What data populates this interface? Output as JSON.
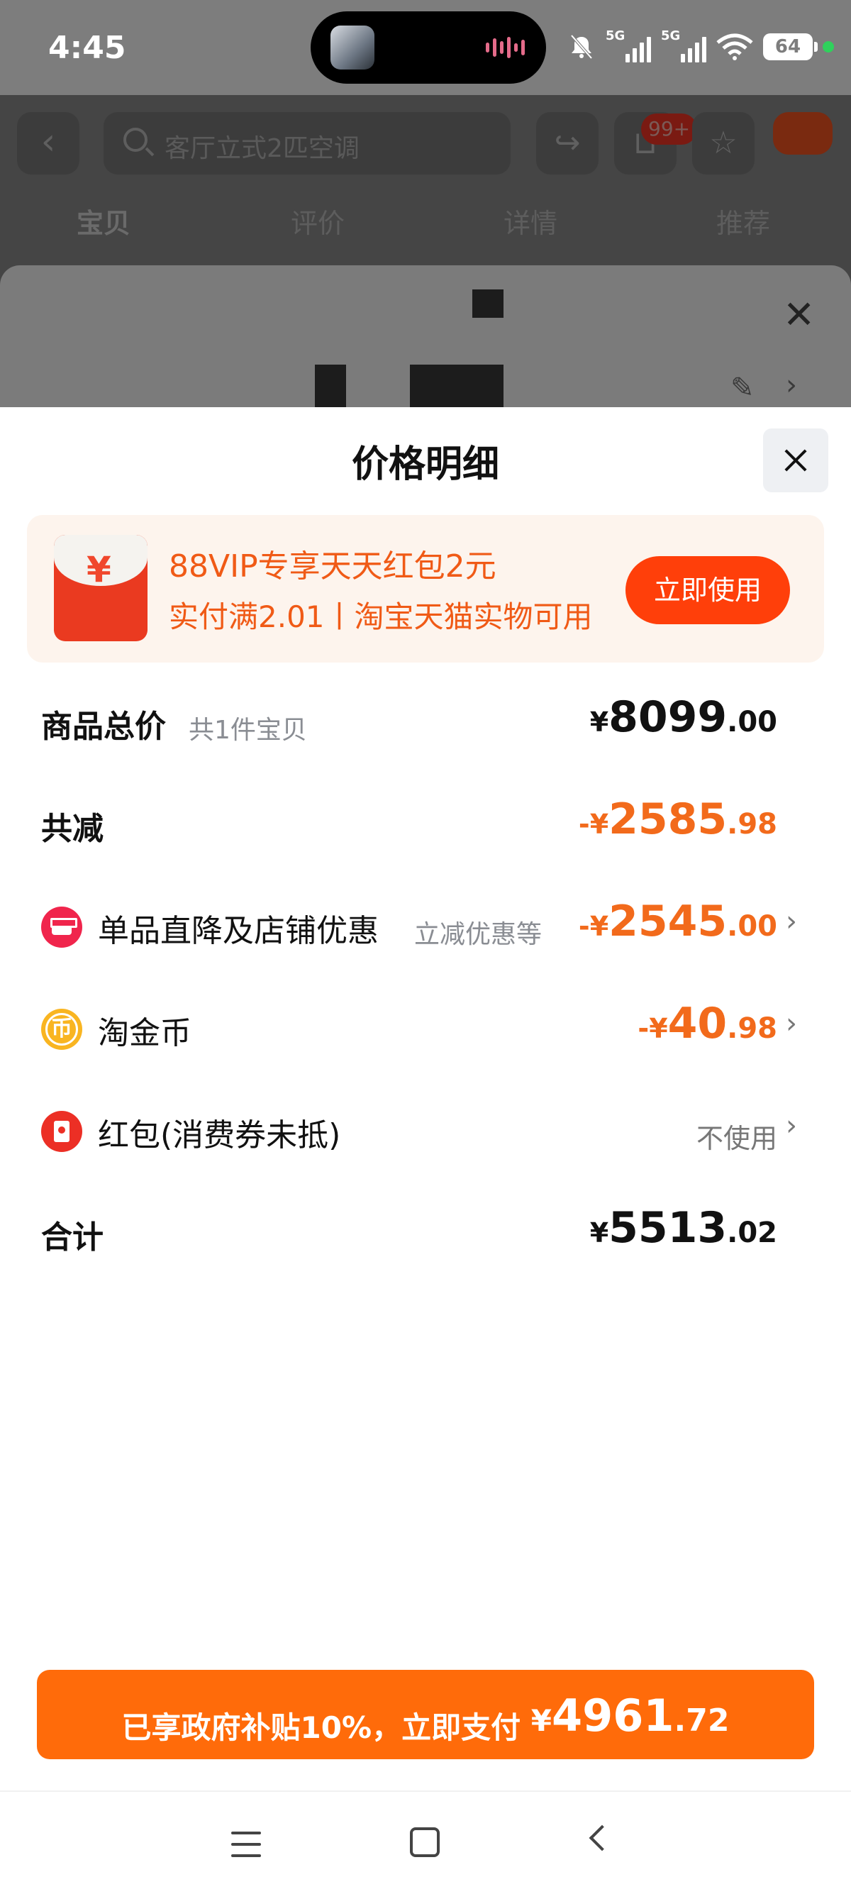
{
  "status_bar": {
    "time": "4:45",
    "network1": "5G",
    "network2": "5G",
    "battery": "64"
  },
  "background": {
    "search_placeholder": "客厅立式2匹空调",
    "cart_badge": "99+",
    "tabs": [
      "宝贝",
      "评价",
      "详情",
      "推荐"
    ]
  },
  "panel": {
    "title": "价格明细",
    "promo": {
      "line1": "88VIP专享天天红包2元",
      "line2": "实付满2.01丨淘宝天猫实物可用",
      "button": "立即使用",
      "icon_glyph": "¥"
    },
    "rows": {
      "total": {
        "label": "商品总价",
        "sublabel": "共1件宝贝",
        "currency": "¥",
        "int": "8099",
        "dec": ".00"
      },
      "reduce": {
        "label": "共减",
        "currency": "-¥",
        "int": "2585",
        "dec": ".98"
      },
      "store": {
        "label": "单品直降及店铺优惠",
        "sublabel": "立减优惠等",
        "currency": "-¥",
        "int": "2545",
        "dec": ".00"
      },
      "coins": {
        "label": "淘金币",
        "currency": "-¥",
        "int": "40",
        "dec": ".98",
        "icon_glyph": "币"
      },
      "redpack": {
        "label": "红包(消费券未抵)",
        "value": "不使用"
      },
      "sum": {
        "label": "合计",
        "currency": "¥",
        "int": "5513",
        "dec": ".02"
      }
    }
  },
  "pay_button": {
    "text": "已享政府补贴10%，立即支付 ",
    "currency": "¥",
    "int": "4961",
    "dec": ".72"
  },
  "colors": {
    "accent_orange": "#ff6b0a",
    "discount_orange": "#f26a1b",
    "promo_button": "#ff3f0a"
  }
}
